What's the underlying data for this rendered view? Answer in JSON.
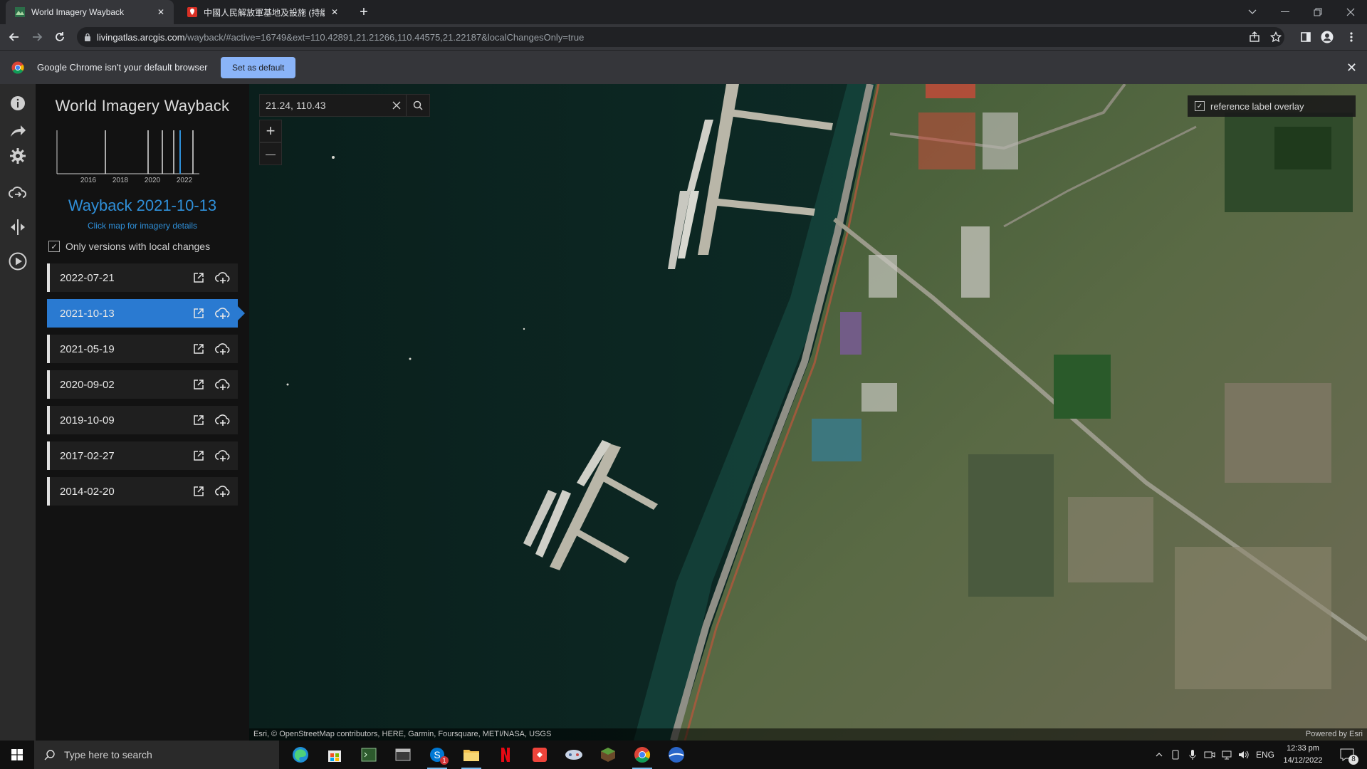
{
  "browser": {
    "tabs": [
      {
        "title": "World Imagery Wayback",
        "active": true
      },
      {
        "title": "中國人民解放軍基地及設施 (持續",
        "active": false
      }
    ],
    "url_host": "livingatlas.arcgis.com",
    "url_path": "/wayback/#active=16749&ext=110.42891,21.21266,110.44575,21.22187&localChangesOnly=true",
    "infobar_message": "Google Chrome isn't your default browser",
    "set_default_label": "Set as default"
  },
  "app": {
    "title": "World Imagery Wayback",
    "timeline_years": [
      "2016",
      "2018",
      "2020",
      "2022"
    ],
    "current_label": "Wayback 2021-10-13",
    "click_hint": "Click map for imagery details",
    "local_changes_label": "Only versions with local changes",
    "local_changes_checked": true,
    "versions": [
      {
        "date": "2022-07-21",
        "selected": false
      },
      {
        "date": "2021-10-13",
        "selected": true
      },
      {
        "date": "2021-05-19",
        "selected": false
      },
      {
        "date": "2020-09-02",
        "selected": false
      },
      {
        "date": "2019-10-09",
        "selected": false
      },
      {
        "date": "2017-02-27",
        "selected": false
      },
      {
        "date": "2014-02-20",
        "selected": false
      }
    ]
  },
  "map": {
    "search_value": "21.24, 110.43",
    "zoom_in": "+",
    "zoom_out": "—",
    "reference_overlay_label": "reference label overlay",
    "reference_overlay_checked": true,
    "attribution": "Esri, © OpenStreetMap contributors, HERE, Garmin, Foursquare, METI/NASA, USGS",
    "powered_by": "Powered by Esri"
  },
  "taskbar": {
    "search_placeholder": "Type here to search",
    "language": "ENG",
    "time": "12:33 pm",
    "date": "14/12/2022",
    "notification_count": "8",
    "badge_count": "1"
  },
  "colors": {
    "accent": "#2a7ad1",
    "link": "#2f8fd8",
    "sea": "#0c2320"
  }
}
